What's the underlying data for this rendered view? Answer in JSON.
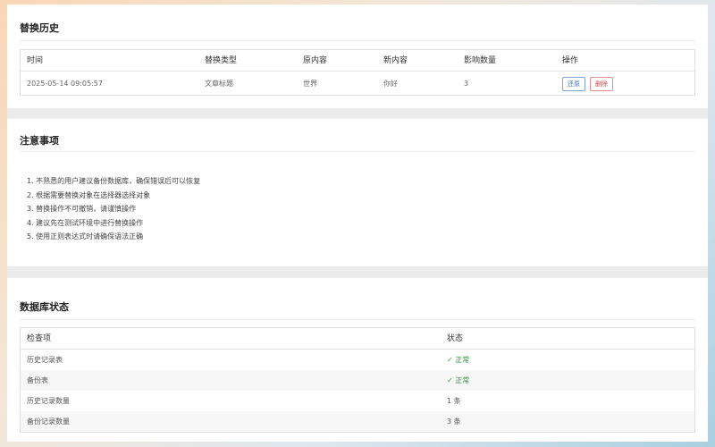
{
  "history": {
    "title": "替换历史",
    "columns": [
      "时间",
      "替换类型",
      "原内容",
      "新内容",
      "影响数量",
      "操作"
    ],
    "rows": [
      {
        "time": "2025-05-14 09:05:57",
        "type": "文章标题",
        "old": "世界",
        "new": "你好",
        "count": "3",
        "restore_label": "还原",
        "delete_label": "删除"
      }
    ]
  },
  "notes": {
    "title": "注意事项",
    "items": [
      "1. 不熟悉的用户建议备份数据库，确保错误后可以恢复",
      "2. 根据需要替换对象在选择器选择对象",
      "3. 替换操作不可撤销，请谨慎操作",
      "4. 建议先在测试环境中进行替换操作",
      "5. 使用正则表达式时请确保语法正确"
    ]
  },
  "db_status": {
    "title": "数据库状态",
    "columns": [
      "检查项",
      "状态"
    ],
    "rows": [
      {
        "item": "历史记录表",
        "status": "✓ 正常",
        "ok": true
      },
      {
        "item": "备份表",
        "status": "✓ 正常",
        "ok": true
      },
      {
        "item": "历史记录数量",
        "status": "1 条",
        "ok": false
      },
      {
        "item": "备份记录数量",
        "status": "3 条",
        "ok": false
      }
    ]
  },
  "colors": {
    "ok_green": "#2e9a3a",
    "restore_blue": "#3b73b5",
    "delete_red": "#c64848"
  }
}
